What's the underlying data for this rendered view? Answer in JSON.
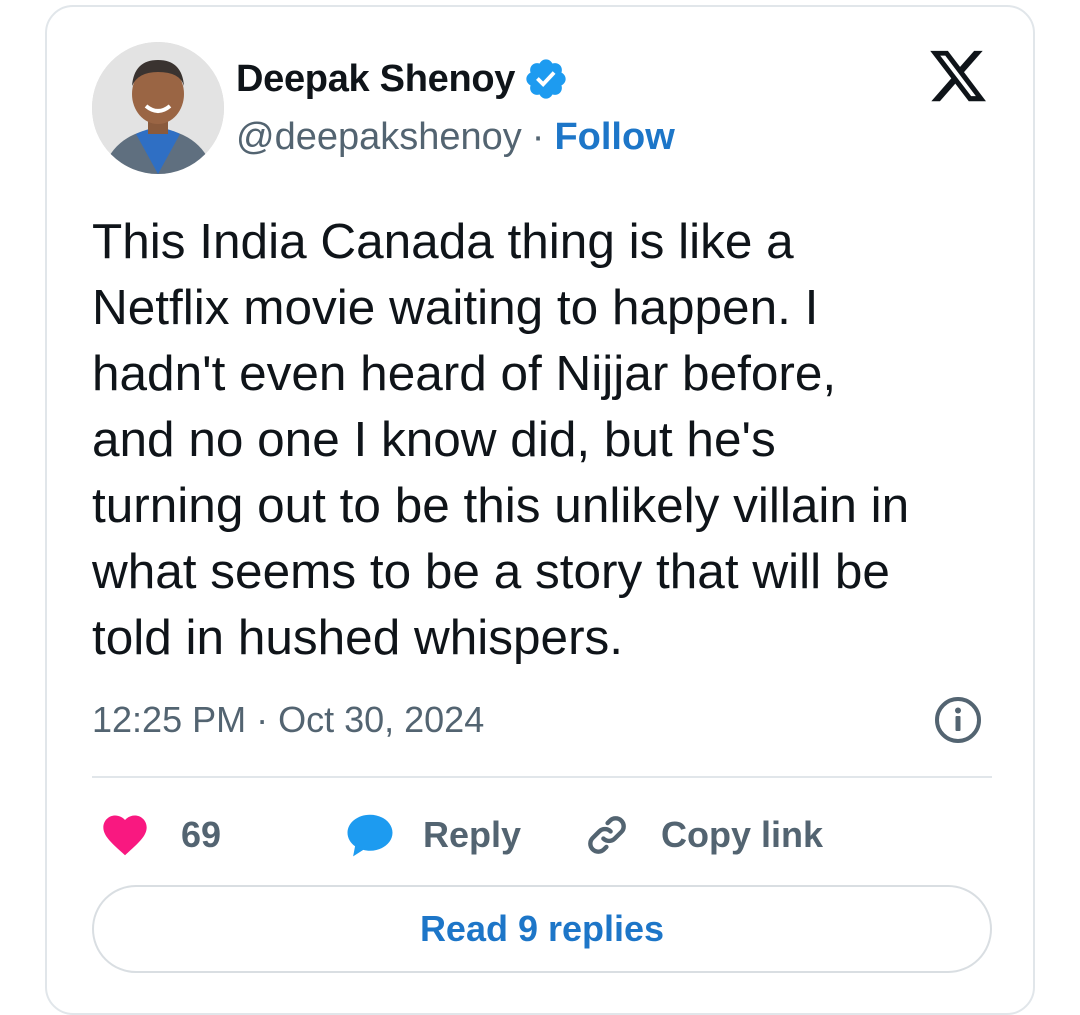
{
  "author": {
    "name": "Deepak Shenoy",
    "handle": "@deepakshenoy",
    "separator": "·",
    "follow_label": "Follow",
    "verified_color": "#1d9bf0"
  },
  "tweet": {
    "lines": [
      "This India Canada thing is like a",
      "Netflix movie waiting to happen. I",
      "hadn't even heard of Nijjar before,",
      "and no one I know did, but he's",
      "turning out to be this unlikely villain in",
      "what seems to be a story that will be",
      "told in hushed whispers."
    ],
    "timestamp": "12:25 PM · Oct 30, 2024"
  },
  "actions": {
    "like_count": "69",
    "reply_label": "Reply",
    "copy_link_label": "Copy link",
    "like_color": "#f91880",
    "reply_color": "#1d9bf0"
  },
  "read_replies_label": "Read 9 replies",
  "icons": {
    "brand": "x-logo-icon",
    "verified": "verified-badge-icon",
    "info": "info-icon",
    "like": "heart-icon",
    "reply": "speech-bubble-icon",
    "copy": "link-icon"
  }
}
